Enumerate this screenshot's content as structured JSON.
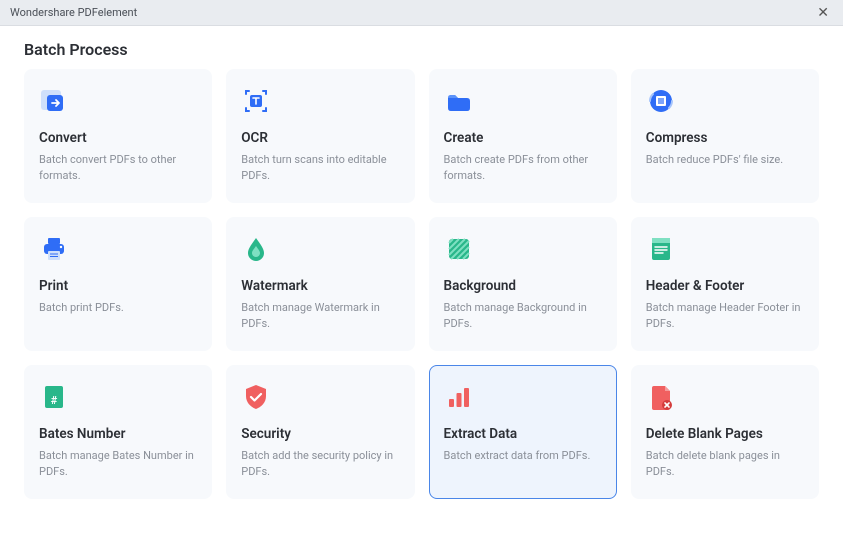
{
  "titlebar": {
    "title": "Wondershare PDFelement",
    "close": "✕"
  },
  "page": {
    "title": "Batch Process"
  },
  "cards": [
    {
      "title": "Convert",
      "desc": "Batch convert PDFs to other formats."
    },
    {
      "title": "OCR",
      "desc": "Batch turn scans into editable PDFs."
    },
    {
      "title": "Create",
      "desc": "Batch create PDFs from other formats."
    },
    {
      "title": "Compress",
      "desc": "Batch reduce PDFs' file size."
    },
    {
      "title": "Print",
      "desc": "Batch print PDFs."
    },
    {
      "title": "Watermark",
      "desc": "Batch manage Watermark in PDFs."
    },
    {
      "title": "Background",
      "desc": "Batch manage Background in PDFs."
    },
    {
      "title": "Header & Footer",
      "desc": "Batch manage Header  Footer in PDFs."
    },
    {
      "title": "Bates Number",
      "desc": "Batch manage Bates Number in PDFs."
    },
    {
      "title": "Security",
      "desc": "Batch add the security policy in PDFs."
    },
    {
      "title": "Extract Data",
      "desc": "Batch extract data from PDFs."
    },
    {
      "title": "Delete Blank Pages",
      "desc": "Batch delete blank pages in PDFs."
    }
  ],
  "selected_index": 10
}
